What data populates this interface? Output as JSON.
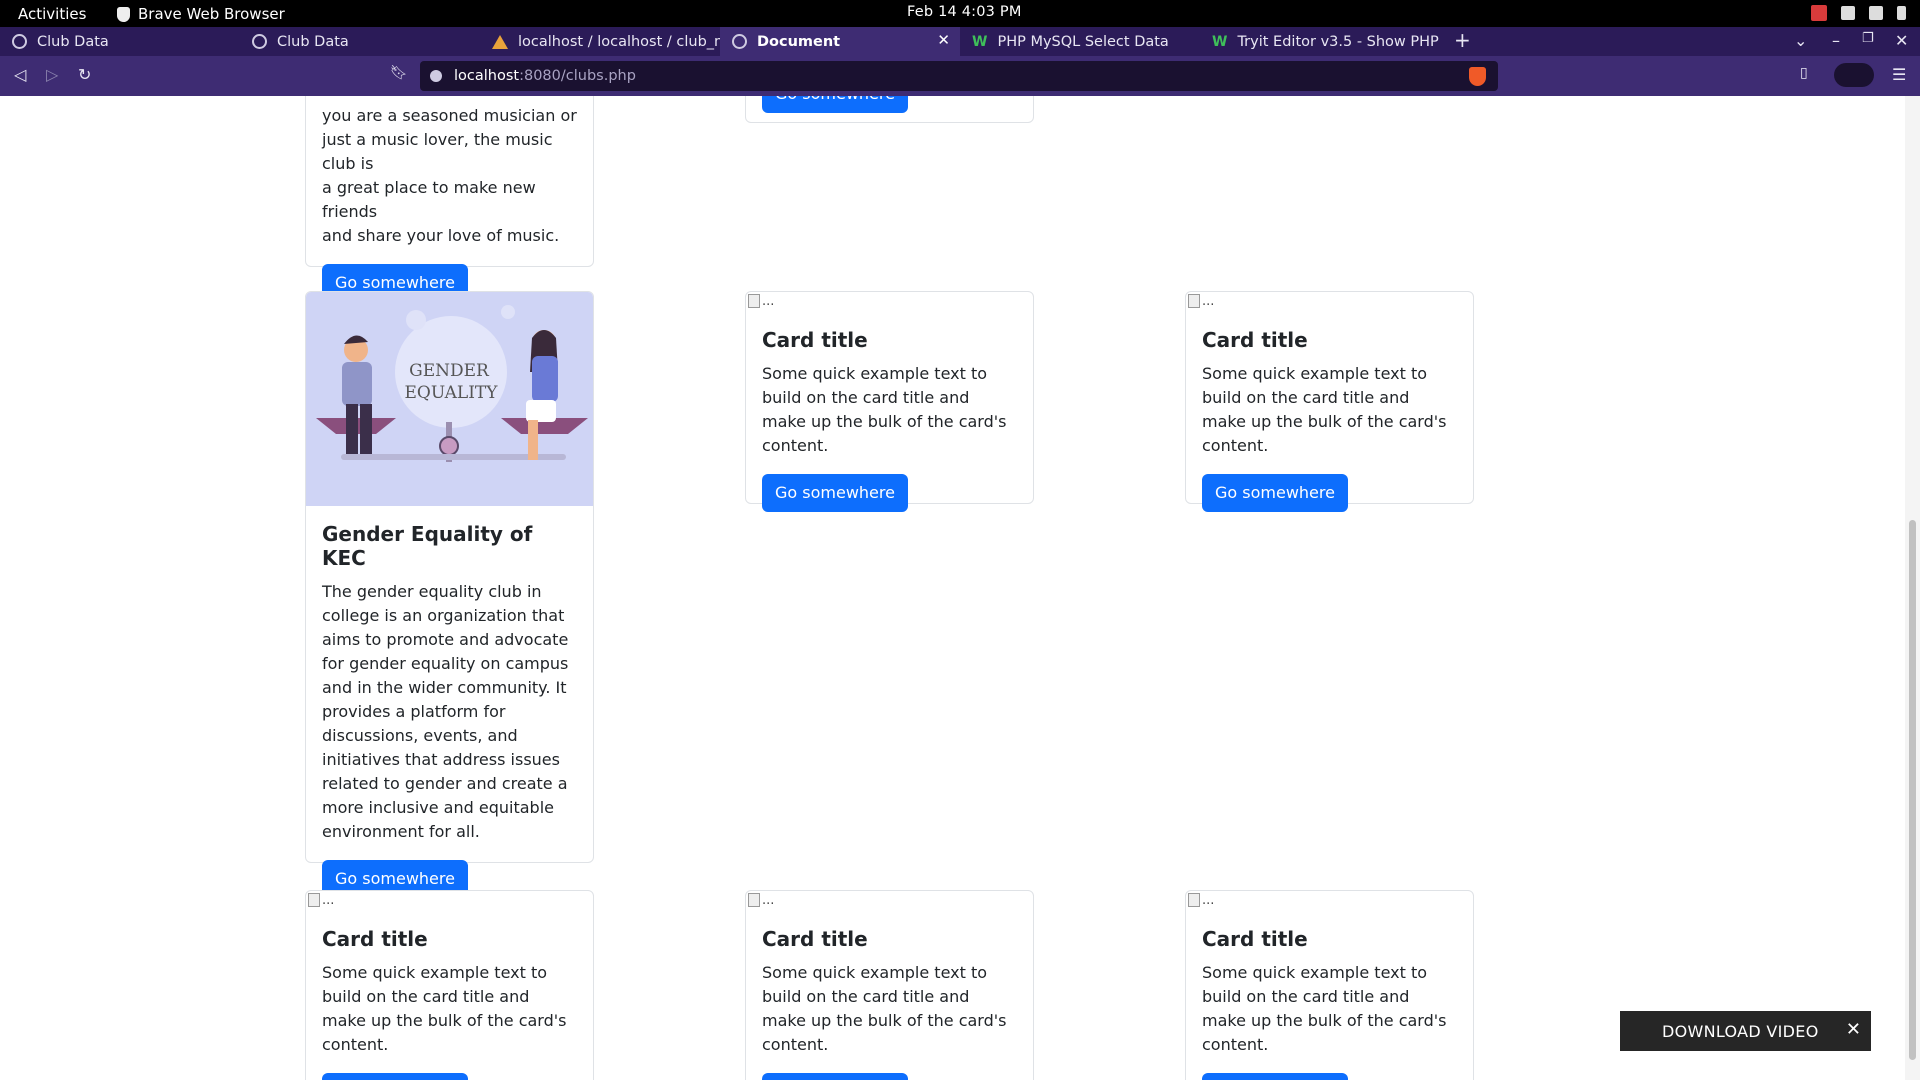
{
  "system": {
    "activities": "Activities",
    "app_name": "Brave Web Browser",
    "clock": "Feb 14  4:03 PM"
  },
  "tabs": [
    {
      "title": "Club Data",
      "icon": "globe-icon"
    },
    {
      "title": "Club Data",
      "icon": "globe-icon"
    },
    {
      "title": "localhost / localhost / club_m",
      "icon": "phpmyadmin-icon"
    },
    {
      "title": "Document",
      "icon": "globe-icon",
      "active": true
    },
    {
      "title": "PHP MySQL Select Data",
      "icon": "w3schools-icon"
    },
    {
      "title": "Tryit Editor v3.5 - Show PHP",
      "icon": "w3schools-icon"
    }
  ],
  "address": {
    "host": "localhost",
    "rest": ":8080/clubs.php"
  },
  "button_label": "Go somewhere",
  "music_card": {
    "text_lines": [
      "you are a seasoned musician or",
      "just a music lover, the music club is",
      "a great place to make new friends",
      "and share your love of music."
    ]
  },
  "gender_card": {
    "image_text_line1": "GENDER",
    "image_text_line2": "EQUALITY",
    "title": "Gender Equality of KEC",
    "text": "The gender equality club in college is an organization that aims to promote and advocate for gender equality on campus and in the wider community. It provides a platform for discussions, events, and initiatives that address issues related to gender and create a more inclusive and equitable environment for all."
  },
  "placeholder_card": {
    "alt": "...",
    "title": "Card title",
    "text": "Some quick example text to build on the card title and make up the bulk of the card's content."
  },
  "download": {
    "label": "DOWNLOAD VIDEO",
    "close": "✕"
  }
}
